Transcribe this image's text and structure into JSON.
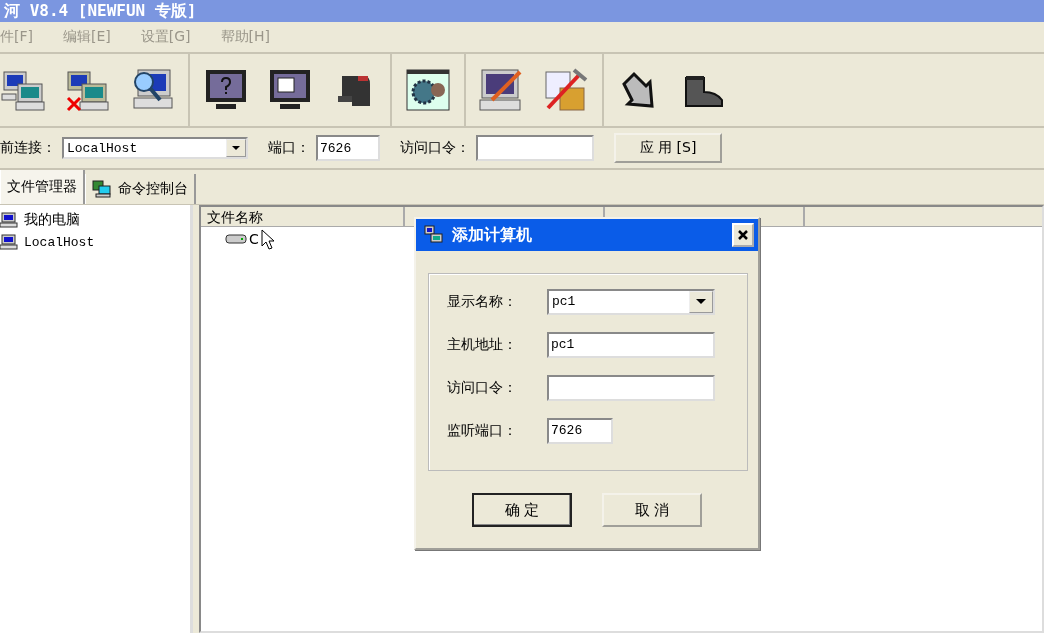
{
  "window": {
    "title": "河 V8.4 [NEWFUN 专版]"
  },
  "menu": [
    {
      "label": "件[F]",
      "disabled": true
    },
    {
      "label": "编辑[E]",
      "disabled": true
    },
    {
      "label": "设置[G]",
      "disabled": true
    },
    {
      "label": "帮助[H]",
      "disabled": true
    }
  ],
  "connection": {
    "label": "前连接：",
    "host": "LocalHost",
    "port_label": "端口：",
    "port": "7626",
    "password_label": "访问口令：",
    "apply": "应 用 [S]"
  },
  "tabs": [
    {
      "label": "文件管理器",
      "selected": true
    },
    {
      "label": "命令控制台",
      "selected": false
    }
  ],
  "tree": [
    {
      "label": "我的电脑"
    },
    {
      "label": "LocalHost"
    }
  ],
  "table": {
    "columns": [
      "文件名称"
    ],
    "rows": [
      {
        "name": "C"
      }
    ]
  },
  "dialog": {
    "title": "添加计算机",
    "fields": [
      {
        "kind": "combo",
        "label": "显示名称：",
        "value": "pc1"
      },
      {
        "kind": "text",
        "label": "主机地址：",
        "value": "pc1"
      },
      {
        "kind": "text",
        "label": "访问口令："
      },
      {
        "kind": "short",
        "label": "监听端口：",
        "value": "7626"
      }
    ],
    "ok": "确 定",
    "cancel": "取 消"
  }
}
